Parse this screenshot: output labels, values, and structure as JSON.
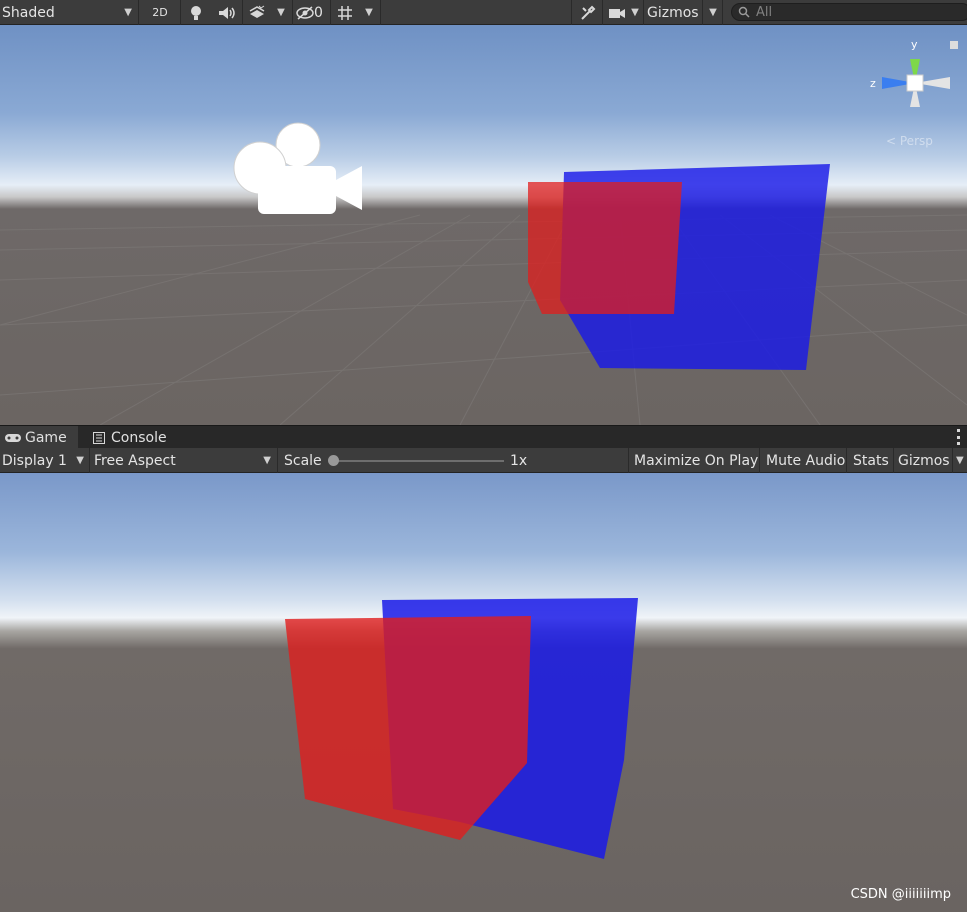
{
  "scene_toolbar": {
    "draw_mode": "Shaded",
    "mode_2d": "2D",
    "hidden_count": "0",
    "gizmos_label": "Gizmos",
    "search_placeholder": "All",
    "icons": [
      "lighting-icon",
      "audio-icon",
      "effects-icon",
      "visibility-icon",
      "grid-icon",
      "tools-icon",
      "camera-icon",
      "search-icon"
    ]
  },
  "scene_view": {
    "gizmo_axes": {
      "y": "y",
      "z": "z"
    },
    "persp_label": "Persp"
  },
  "tabs": [
    {
      "label": "Game",
      "icon": "gamepad-icon",
      "active": true
    },
    {
      "label": "Console",
      "icon": "console-icon",
      "active": false
    }
  ],
  "game_toolbar": {
    "display": "Display 1",
    "aspect": "Free Aspect",
    "scale_label": "Scale",
    "scale_value": "1x",
    "scale_fraction": 0.0,
    "maximize_on_play": "Maximize On Play",
    "mute_audio": "Mute Audio",
    "stats": "Stats",
    "gizmos": "Gizmos"
  },
  "watermark": "CSDN @iiiiiiimp",
  "colors": {
    "red_cube": "#e01e1e",
    "blue_cube": "#1a1ae8",
    "toolbar_bg": "#3c3c3c",
    "tab_bg": "#282828"
  }
}
